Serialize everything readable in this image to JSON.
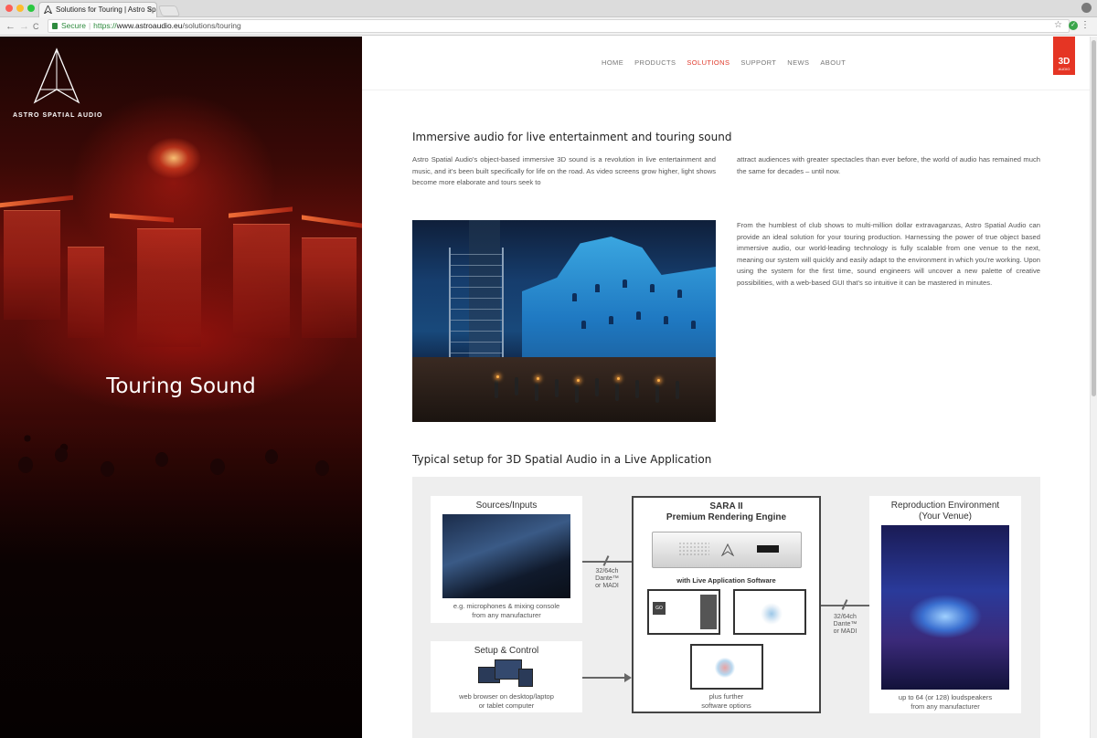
{
  "browser": {
    "tab_title": "Solutions for Touring | Astro Sp",
    "tab_close": "×",
    "secure_label": "Secure",
    "url_scheme": "https://",
    "url_host": "www.astroaudio.eu",
    "url_path": "/solutions/touring",
    "back": "←",
    "forward": "→",
    "reload": "C",
    "star": "☆",
    "menu": "⋮"
  },
  "hero": {
    "logo_text": "ASTRO SPATIAL AUDIO",
    "title": "Touring Sound"
  },
  "nav": {
    "items": [
      "HOME",
      "PRODUCTS",
      "SOLUTIONS",
      "SUPPORT",
      "NEWS",
      "ABOUT"
    ],
    "active": "SOLUTIONS",
    "badge_big": "3D",
    "badge_small": "AUDIO"
  },
  "section1": {
    "heading": "Immersive audio for live entertainment and touring sound",
    "col1": "Astro Spatial Audio's object-based immersive 3D sound is a revolution in live entertainment and music, and it's been built specifically for life on the road. As video screens grow higher, light shows become more elaborate and tours seek to",
    "col2": "attract audiences with greater spectacles than ever before, the world of audio has remained much the same for decades – until now."
  },
  "section2": {
    "text": "From the humblest of club shows to multi-million dollar extravaganzas, Astro Spatial Audio can provide an ideal solution for your touring production. Harnessing the power of true object based immersive audio, our world-leading technology is fully scalable from one venue to the next, meaning our system will quickly and easily adapt to the environment in which you're working. Upon using the system for the first time, sound engineers will uncover a new palette of creative possibilities, with a web-based GUI that's so intuitive it can be mastered in minutes."
  },
  "section3": {
    "heading": "Typical setup for 3D Spatial Audio in a Live Application"
  },
  "diagram": {
    "sources_title": "Sources/Inputs",
    "sources_sub1": "e.g. microphones & mixing console",
    "sources_sub2": "from any manufacturer",
    "link1_line1": "32/64ch",
    "link1_line2": "Dante™",
    "link1_line3": "or MADI",
    "sara_title1": "SARA II",
    "sara_title2": "Premium Rendering Engine",
    "sara_software": "with Live Application Software",
    "sara_go": "GO",
    "sara_sub1": "plus further",
    "sara_sub2": "software options",
    "setup_title": "Setup & Control",
    "setup_sub1": "web browser on desktop/laptop",
    "setup_sub2": "or tablet computer",
    "link2_line1": "32/64ch",
    "link2_line2": "Dante™",
    "link2_line3": "or MADI",
    "repro_title1": "Reproduction Environment",
    "repro_title2": "(Your Venue)",
    "repro_sub1": "up to 64 (or 128) loudspeakers",
    "repro_sub2": "from any manufacturer"
  },
  "colors": {
    "accent": "#e03a2b",
    "badge": "#e53524",
    "hero_red": "#6b0f0a"
  }
}
